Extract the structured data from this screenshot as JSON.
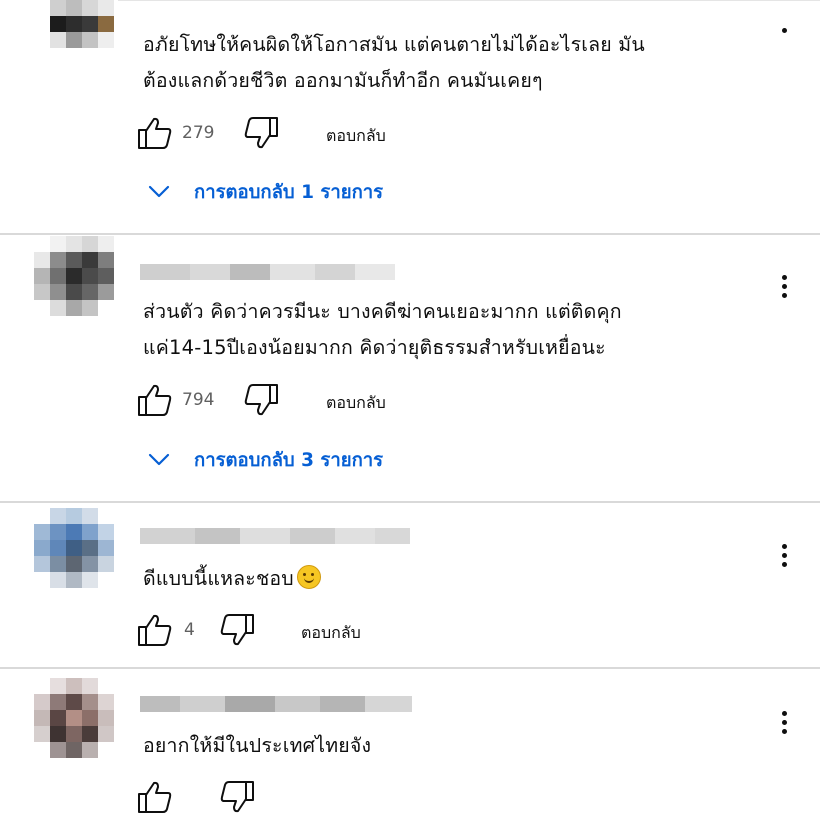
{
  "comments": [
    {
      "avatar_blurred": true,
      "lines": [
        "อภัยโทษให้คนผิดให้โอกาสมัน แต่คนตายไม่ได้อะไรเลย มัน",
        "ต้องแลกด้วยชีวิต ออกมามันก็ทำอีก คนมันเคยๆ"
      ],
      "likes": "279",
      "reply_label": "ตอบกลับ",
      "replies_label": "การตอบกลับ 1 รายการ"
    },
    {
      "avatar_blurred": true,
      "name_blurred": true,
      "lines": [
        "ส่วนตัว คิดว่าควรมีนะ บางคดีฆ่าคนเยอะมากก แต่ติดคุก",
        "แค่14-15ปีเองน้อยมากก คิดว่ายุติธรรมสำหรับเหยื่อนะ"
      ],
      "likes": "794",
      "reply_label": "ตอบกลับ",
      "replies_label": "การตอบกลับ 3 รายการ"
    },
    {
      "avatar_blurred": true,
      "name_blurred": true,
      "text": "ดีแบบนี้แหละชอบ",
      "emoji": "smiling-face",
      "likes": "4",
      "reply_label": "ตอบกลับ"
    },
    {
      "avatar_blurred": true,
      "name_blurred": true,
      "text": "อยากให้มีในประเทศไทยจัง"
    }
  ],
  "colors": {
    "link_blue": "#065fd4",
    "text": "#0f0f0f",
    "secondary_text": "#606060",
    "separator": "#d9d9d9"
  },
  "icons": {
    "like": "thumbs-up-icon",
    "dislike": "thumbs-down-icon",
    "more": "more-vert-icon",
    "expand": "chevron-down-icon"
  }
}
